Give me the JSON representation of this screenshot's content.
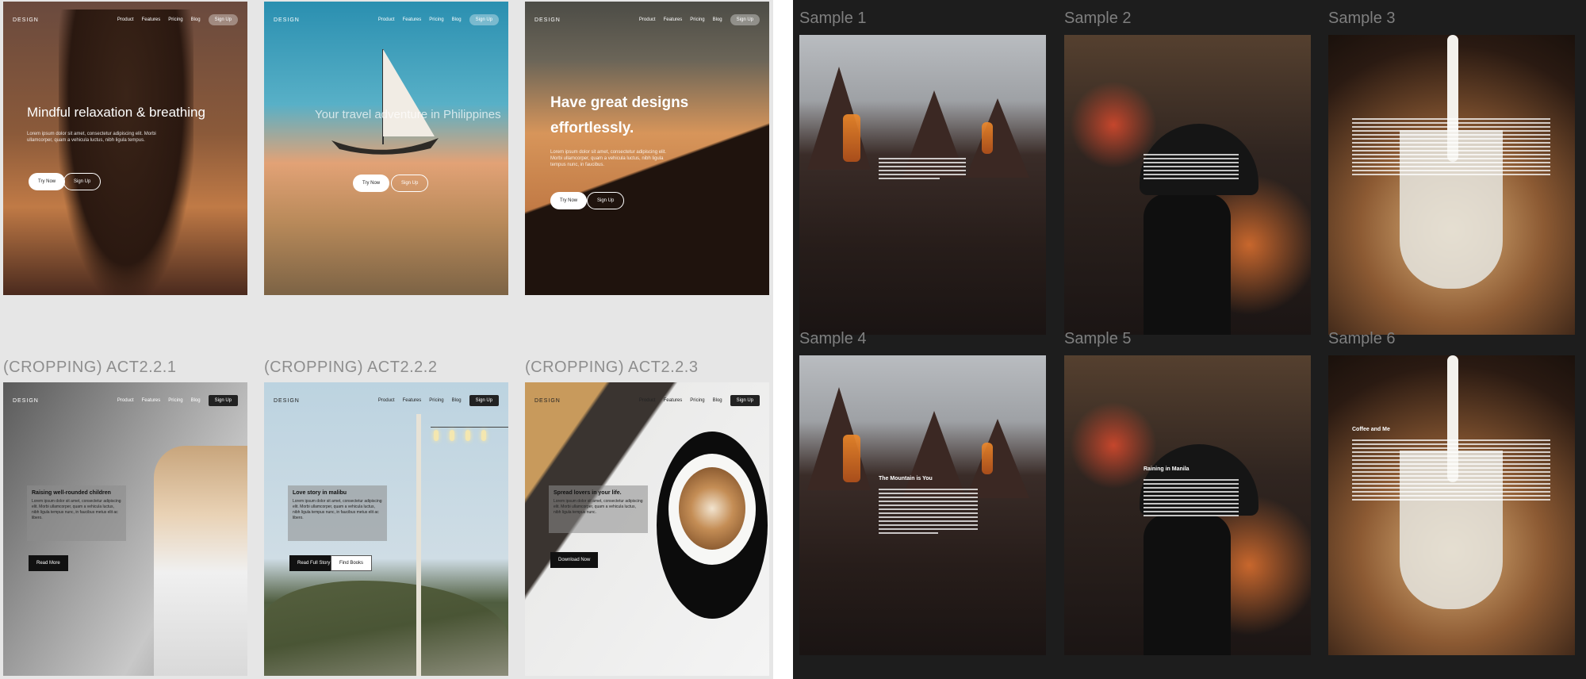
{
  "left": {
    "cards_top": [
      {
        "logo": "DESIGN",
        "nav": [
          "Product",
          "Features",
          "Pricing",
          "Blog"
        ],
        "cta": "Sign Up",
        "title": "Mindful relaxation & breathing",
        "body": "Lorem ipsum dolor sit amet, consectetur adipiscing elit. Morbi ullamcorper, quam a vehicula luctus, nibh ligula tempus.",
        "primary": "Try Now",
        "secondary": "Sign Up"
      },
      {
        "logo": "DESIGN",
        "nav": [
          "Product",
          "Features",
          "Pricing",
          "Blog"
        ],
        "cta": "Sign Up",
        "title": "Your travel adventure in Philippines",
        "body": "",
        "primary": "Try Now",
        "secondary": "Sign Up"
      },
      {
        "logo": "DESIGN",
        "nav": [
          "Product",
          "Features",
          "Pricing",
          "Blog"
        ],
        "cta": "Sign Up",
        "title": "Have great designs effortlessly.",
        "body": "Lorem ipsum dolor sit amet, consectetur adipiscing elit. Morbi ullamcorper, quam a vehicula luctus, nibh ligula tempus nunc, in faucibus.",
        "primary": "Try Now",
        "secondary": "Sign Up"
      }
    ],
    "sections": [
      {
        "label": "(CROPPING) ACT2.2.1"
      },
      {
        "label": "(CROPPING) ACT2.2.2"
      },
      {
        "label": "(CROPPING) ACT2.2.3"
      }
    ],
    "cards_bottom": [
      {
        "logo": "DESIGN",
        "nav": [
          "Product",
          "Features",
          "Pricing",
          "Blog"
        ],
        "cta": "Sign Up",
        "title": "Raising well-rounded children",
        "body": "Lorem ipsum dolor sit amet, consectetur adipiscing elit. Morbi ullamcorper, quam a vehicula luctus, nibh ligula tempus nunc, in faucibus metus elit ac libero.",
        "primary": "Read More",
        "secondary": ""
      },
      {
        "logo": "DESIGN",
        "nav": [
          "Product",
          "Features",
          "Pricing",
          "Blog"
        ],
        "cta": "Sign Up",
        "title": "Love story in malibu",
        "body": "Lorem ipsum dolor sit amet, consectetur adipiscing elit. Morbi ullamcorper, quam a vehicula luctus, nibh ligula tempus nunc, in faucibus metus elit ac libero.",
        "primary": "Read Full Story",
        "secondary": "Find Books"
      },
      {
        "logo": "DESIGN",
        "nav": [
          "Product",
          "Features",
          "Pricing",
          "Blog"
        ],
        "cta": "Sign Up",
        "title": "Spread lovers in your life.",
        "body": "Lorem ipsum dolor sit amet, consectetur adipiscing elit. Morbi ullamcorper, quam a vehicula luctus, nibh ligula tempus nunc.",
        "primary": "Download Now",
        "secondary": ""
      }
    ]
  },
  "right": {
    "samples": [
      {
        "label": "Sample 1",
        "title": "",
        "theme": "mountain"
      },
      {
        "label": "Sample 2",
        "title": "",
        "theme": "rain"
      },
      {
        "label": "Sample 3",
        "title": "",
        "theme": "latte"
      },
      {
        "label": "Sample 4",
        "title": "The Mountain is You",
        "theme": "mountain"
      },
      {
        "label": "Sample 5",
        "title": "Raining in Manila",
        "theme": "rain"
      },
      {
        "label": "Sample 6",
        "title": "Coffee and Me",
        "theme": "latte"
      }
    ]
  },
  "colors": {
    "left_bg": "#e6e6e6",
    "right_bg": "#1d1d1d",
    "label_gray": "#8e8e8e"
  }
}
